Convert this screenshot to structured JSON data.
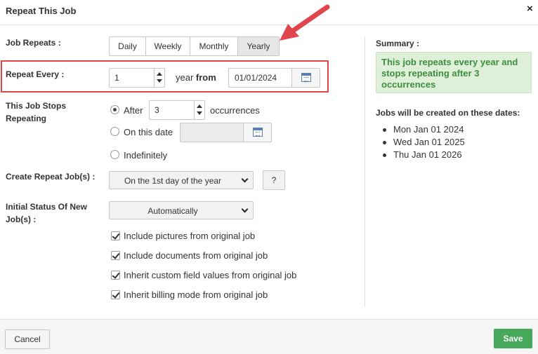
{
  "dialog": {
    "title": "Repeat This Job",
    "close_label": "×"
  },
  "job_repeats": {
    "label": "Job Repeats :",
    "options": [
      "Daily",
      "Weekly",
      "Monthly",
      "Yearly"
    ],
    "selected": "Yearly"
  },
  "repeat_every": {
    "label": "Repeat Every :",
    "value": "1",
    "unit": "year",
    "from_label": "from",
    "from_date": "01/01/2024"
  },
  "stops": {
    "label_line1": "This Job Stops",
    "label_line2": "Repeating",
    "after_label": "After",
    "after_value": "3",
    "occurrences_label": "occurrences",
    "on_date_label": "On this date",
    "on_date_value": "",
    "indefinitely_label": "Indefinitely",
    "selected": "After"
  },
  "create_repeat": {
    "label": "Create Repeat Job(s) :",
    "selected": "On the 1st day of the year",
    "help_label": "?"
  },
  "initial_status": {
    "label_line1": "Initial Status Of New",
    "label_line2": "Job(s) :",
    "selected": "Automatically"
  },
  "checkboxes": [
    {
      "label": "Include pictures from original job",
      "checked": true
    },
    {
      "label": "Include documents from original job",
      "checked": true
    },
    {
      "label": "Inherit custom field values from original job",
      "checked": true
    },
    {
      "label": "Inherit billing mode from original job",
      "checked": true
    }
  ],
  "summary": {
    "label": "Summary :",
    "text": "This job repeats every year and stops repeating after 3 occurrences",
    "dates_label": "Jobs will be created on these dates:",
    "dates": [
      "Mon Jan 01 2024",
      "Wed Jan 01 2025",
      "Thu Jan 01 2026"
    ]
  },
  "footer": {
    "cancel_label": "Cancel",
    "save_label": "Save"
  },
  "colors": {
    "highlight": "#e0454c",
    "save": "#46a85a",
    "summary_bg": "#dff0d8",
    "summary_text": "#3c8d3c"
  }
}
